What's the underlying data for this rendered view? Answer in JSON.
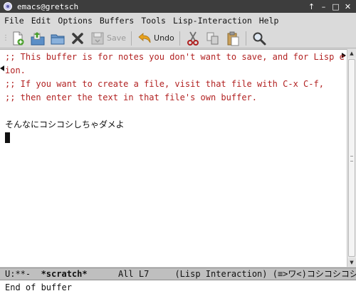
{
  "window": {
    "title": "emacs@gretsch",
    "buttons": [
      "↑",
      "–",
      "□",
      "✕"
    ]
  },
  "menubar": {
    "items": [
      "File",
      "Edit",
      "Options",
      "Buffers",
      "Tools",
      "Lisp-Interaction",
      "Help"
    ]
  },
  "toolbar": {
    "buttons": [
      {
        "name": "new-file",
        "icon": "new-file-icon",
        "label": ""
      },
      {
        "name": "open-file",
        "icon": "open-file-icon",
        "label": ""
      },
      {
        "name": "open-directory",
        "icon": "folder-icon",
        "label": ""
      },
      {
        "name": "close-buffer",
        "icon": "close-x-icon",
        "label": ""
      },
      {
        "name": "save",
        "icon": "save-icon",
        "label": "Save",
        "enabled": false
      },
      {
        "name": "undo",
        "icon": "undo-icon",
        "label": "Undo",
        "enabled": true
      },
      {
        "name": "cut",
        "icon": "scissors-icon",
        "label": ""
      },
      {
        "name": "copy",
        "icon": "copy-icon",
        "label": ""
      },
      {
        "name": "paste",
        "icon": "paste-icon",
        "label": ""
      },
      {
        "name": "search",
        "icon": "magnifier-icon",
        "label": ""
      }
    ]
  },
  "buffer": {
    "lines": [
      ";; This buffer is for notes you don't want to save, and for Lisp evaluat",
      "ion.",
      ";; If you want to create a file, visit that file with C-x C-f,",
      ";; then enter the text in that file's own buffer.",
      "",
      "そんなにコシコシしちゃダメよ"
    ]
  },
  "modeline": {
    "status": "U:**-",
    "buffer_name": "*scratch*",
    "position": "All L7",
    "mode": "(Lisp Interaction) (≡>ワ<)コシコシコシ"
  },
  "echo_area": {
    "message": "End of buffer"
  },
  "colors": {
    "comment": "#b22222",
    "titlebar": "#3d3d3d",
    "modeline": "#bfbfbf"
  }
}
